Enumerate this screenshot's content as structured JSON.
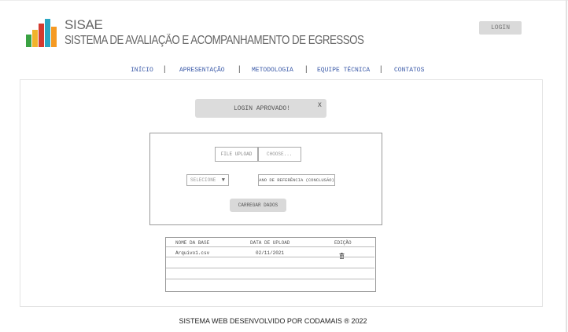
{
  "header": {
    "logo_colors": [
      "#f59a23",
      "#3aa243",
      "#2aa6c2",
      "#4a8fd8",
      "#f1b32b",
      "#d43a2f"
    ],
    "title_short": "SISAE",
    "title_long": "SISTEMA DE AVALIAÇÃO E ACOMPANHAMENTO DE EGRESSOS",
    "login_label": "LOGIN"
  },
  "nav": {
    "items": [
      "INÍCIO",
      "APRESENTAÇÃO",
      "METODOLOGIA",
      "EQUIPE TÉCNICA",
      "CONTATOS"
    ],
    "separator": "|"
  },
  "toast": {
    "message": "LOGIN APROVADO!",
    "close": "X"
  },
  "form": {
    "file_upload_label": "FILE UPLOAD",
    "choose_placeholder": "CHOOSE...",
    "select_placeholder": "SELECIONE",
    "year_label": "ANO DE REFERÊNCIA (CONCLUSÃO)",
    "submit_label": "CARREGAR DADOS"
  },
  "table": {
    "headers": [
      "NOME DA BASE",
      "DATA DE UPLOAD",
      "EDIÇÃO"
    ],
    "rows": [
      {
        "name": "Arquivo1.csv",
        "date": "02/11/2021"
      }
    ]
  },
  "footer": {
    "text": "SISTEMA WEB DESENVOLVIDO POR CODAMAIS ® 2022"
  }
}
